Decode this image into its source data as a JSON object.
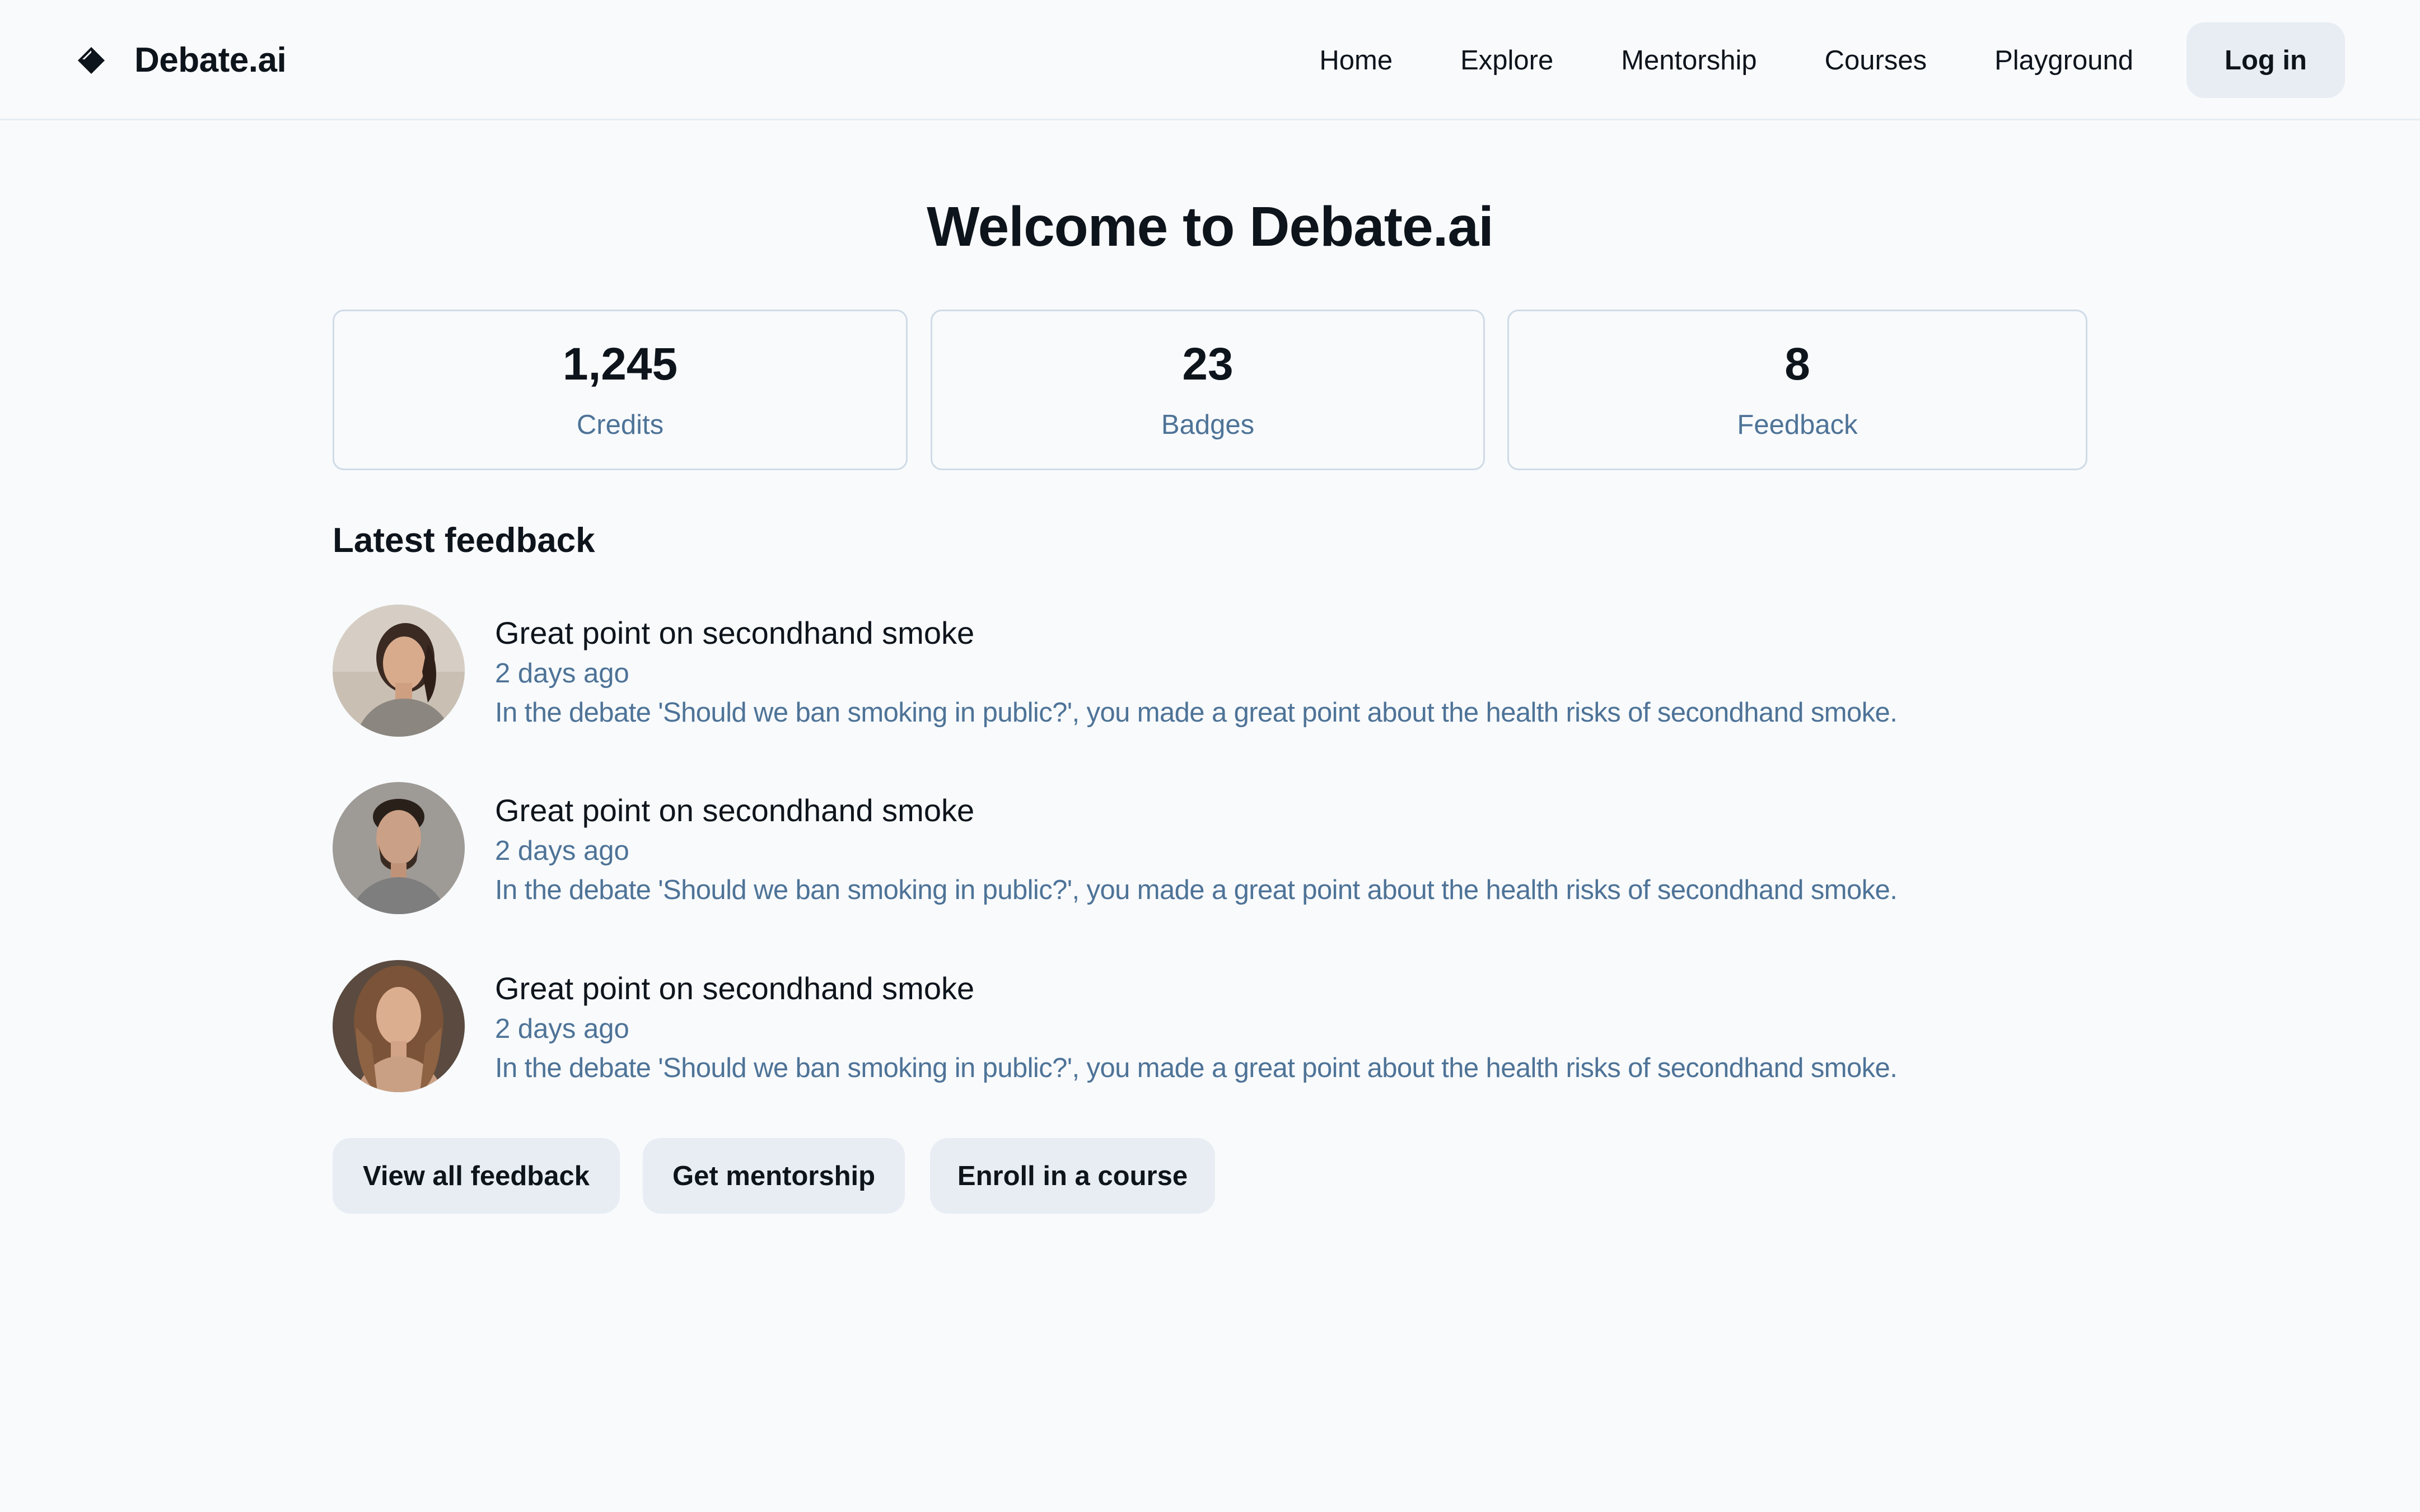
{
  "header": {
    "brand_name": "Debate.ai",
    "brand_icon": "diamond-logo-icon",
    "nav": [
      {
        "label": "Home"
      },
      {
        "label": "Explore"
      },
      {
        "label": "Mentorship"
      },
      {
        "label": "Courses"
      },
      {
        "label": "Playground"
      }
    ],
    "login_label": "Log in"
  },
  "main": {
    "title": "Welcome to Debate.ai",
    "stats": [
      {
        "value": "1,245",
        "label": "Credits"
      },
      {
        "value": "23",
        "label": "Badges"
      },
      {
        "value": "8",
        "label": "Feedback"
      }
    ],
    "feedback_section_title": "Latest feedback",
    "feedback": [
      {
        "title": "Great point on secondhand smoke",
        "time": "2 days ago",
        "text": "In the debate 'Should we ban smoking in public?', you made a great point about the health risks of secondhand smoke."
      },
      {
        "title": "Great point on secondhand smoke",
        "time": "2 days ago",
        "text": "In the debate 'Should we ban smoking in public?', you made a great point about the health risks of secondhand smoke."
      },
      {
        "title": "Great point on secondhand smoke",
        "time": "2 days ago",
        "text": "In the debate 'Should we ban smoking in public?', you made a great point about the health risks of secondhand smoke."
      }
    ],
    "actions": [
      {
        "label": "View all feedback"
      },
      {
        "label": "Get mentorship"
      },
      {
        "label": "Enroll in a course"
      }
    ]
  },
  "colors": {
    "background": "#f8fafc",
    "text_primary": "#0e141b",
    "text_secondary": "#4e7397",
    "button_bg": "#e7edf3",
    "border": "#d0dbe7"
  }
}
